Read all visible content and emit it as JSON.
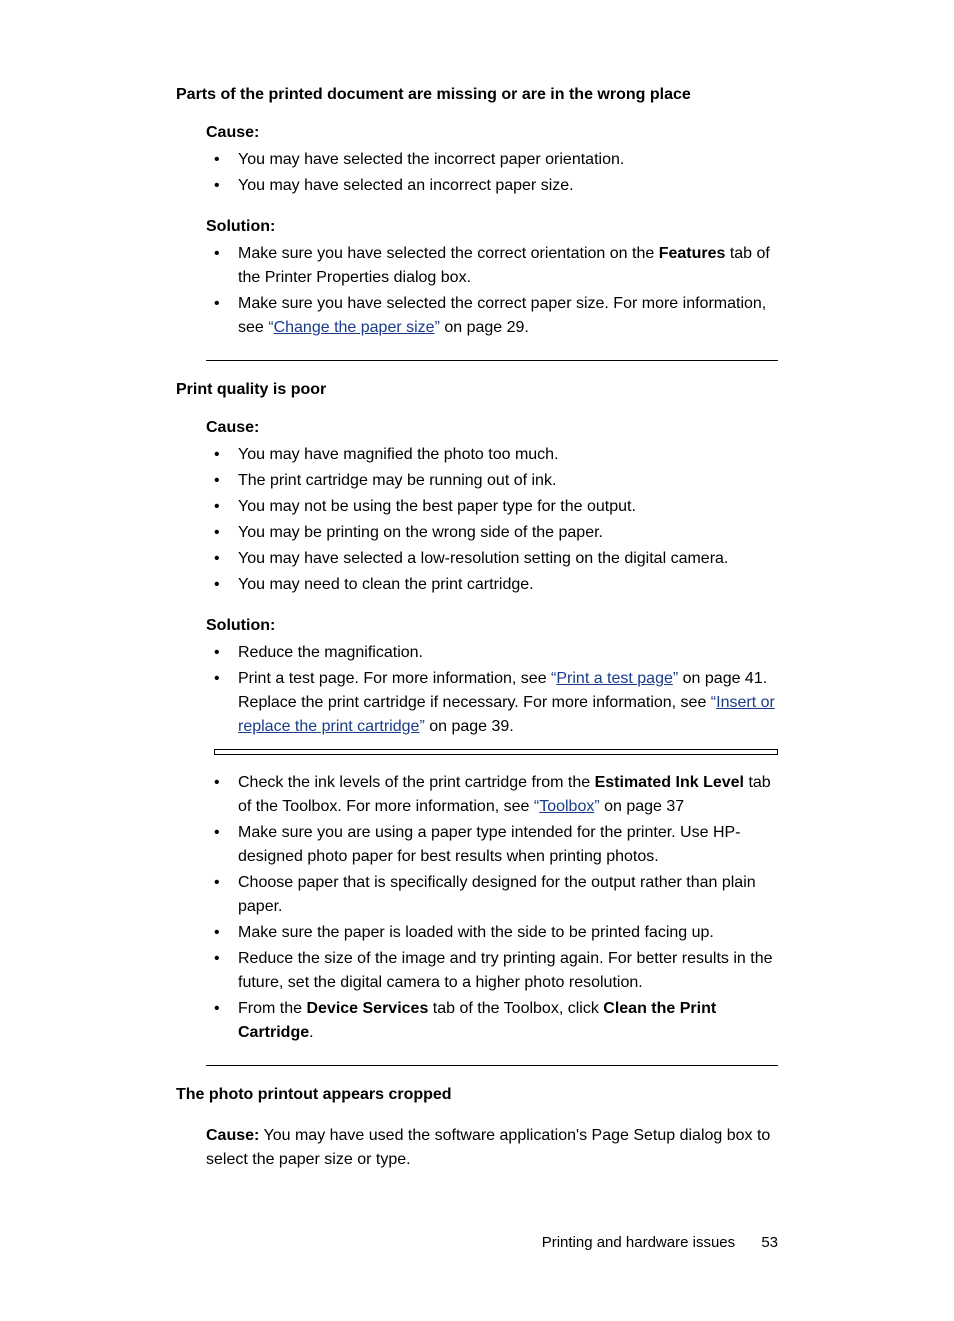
{
  "section1": {
    "title": "Parts of the printed document are missing or are in the wrong place",
    "cause": {
      "label": "Cause:",
      "items": [
        "You may have selected the incorrect paper orientation.",
        "You may have selected an incorrect paper size."
      ]
    },
    "solution": {
      "label": "Solution:",
      "item1": {
        "pre": "Make sure you have selected the correct orientation on the ",
        "bold": "Features",
        "post": " tab of the Printer Properties dialog box."
      },
      "item2": {
        "pre": "Make sure you have selected the correct paper size. For more information, see ",
        "linkQuoteOpen": "“",
        "linkText": "Change the paper size",
        "linkQuoteClose": "”",
        "post": " on page 29."
      }
    }
  },
  "section2": {
    "title": "Print quality is poor",
    "cause": {
      "label": "Cause:",
      "items": [
        "You may have magnified the photo too much.",
        "The print cartridge may be running out of ink.",
        "You may not be using the best paper type for the output.",
        "You may be printing on the wrong side of the paper.",
        "You may have selected a low-resolution setting on the digital camera.",
        "You may need to clean the print cartridge."
      ]
    },
    "solution": {
      "label": "Solution:",
      "item1": "Reduce the magnification.",
      "item2": {
        "pre1": "Print a test page. For more information, see ",
        "q1open": "“",
        "link1": "Print a test page",
        "q1close": "”",
        "mid": " on page 41. Replace the print cartridge if necessary. For more information, see ",
        "q2open": "“",
        "link2": "Insert or replace the print cartridge",
        "q2close": "”",
        "post": " on page 39."
      },
      "item3": {
        "pre": "Check the ink levels of the print cartridge from the ",
        "bold": "Estimated Ink Level",
        "mid": " tab of the Toolbox. For more information, see ",
        "qopen": "“",
        "link": "Toolbox",
        "qclose": "”",
        "post": " on page 37"
      },
      "item4": "Make sure you are using a paper type intended for the printer. Use HP-designed photo paper for best results when printing photos.",
      "item5": "Choose paper that is specifically designed for the output rather than plain paper.",
      "item6": "Make sure the paper is loaded with the side to be printed facing up.",
      "item7": "Reduce the size of the image and try printing again. For better results in the future, set the digital camera to a higher photo resolution.",
      "item8": {
        "pre": "From the ",
        "bold1": "Device Services",
        "mid": " tab of the Toolbox, click ",
        "bold2": "Clean the Print Cartridge",
        "post": "."
      }
    }
  },
  "section3": {
    "title": "The photo printout appears cropped",
    "cause": {
      "label": "Cause:",
      "text": "   You may have used the software application's Page Setup dialog box to select the paper size or type."
    }
  },
  "footer": {
    "text": "Printing and hardware issues",
    "page": "53"
  }
}
